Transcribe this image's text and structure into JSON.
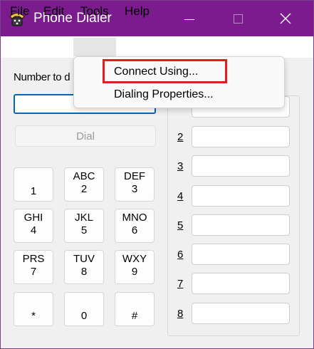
{
  "window": {
    "title": "Phone Dialer"
  },
  "menubar": {
    "file": "File",
    "edit": "Edit",
    "tools": "Tools",
    "help": "Help"
  },
  "tools_menu": {
    "connect_using": "Connect Using...",
    "dialing_properties": "Dialing Properties..."
  },
  "number_label": "Number to d",
  "dial_button": "Dial",
  "keypad": [
    {
      "top": "",
      "bottom": "1"
    },
    {
      "top": "ABC",
      "bottom": "2"
    },
    {
      "top": "DEF",
      "bottom": "3"
    },
    {
      "top": "GHI",
      "bottom": "4"
    },
    {
      "top": "JKL",
      "bottom": "5"
    },
    {
      "top": "MNO",
      "bottom": "6"
    },
    {
      "top": "PRS",
      "bottom": "7"
    },
    {
      "top": "TUV",
      "bottom": "8"
    },
    {
      "top": "WXY",
      "bottom": "9"
    },
    {
      "top": "",
      "bottom": "*"
    },
    {
      "top": "",
      "bottom": "0"
    },
    {
      "top": "",
      "bottom": "#"
    }
  ],
  "speed_dial": {
    "labels": [
      "2",
      "3",
      "4",
      "5",
      "6",
      "7",
      "8"
    ]
  },
  "colors": {
    "titlebar": "#7b1b8e",
    "focus_border": "#0067c0",
    "annotation_red": "#e01e1e"
  },
  "icons": {
    "app": "phone-dialer-app-icon",
    "minimize": "minimize-icon",
    "maximize": "maximize-icon",
    "close": "close-icon"
  }
}
